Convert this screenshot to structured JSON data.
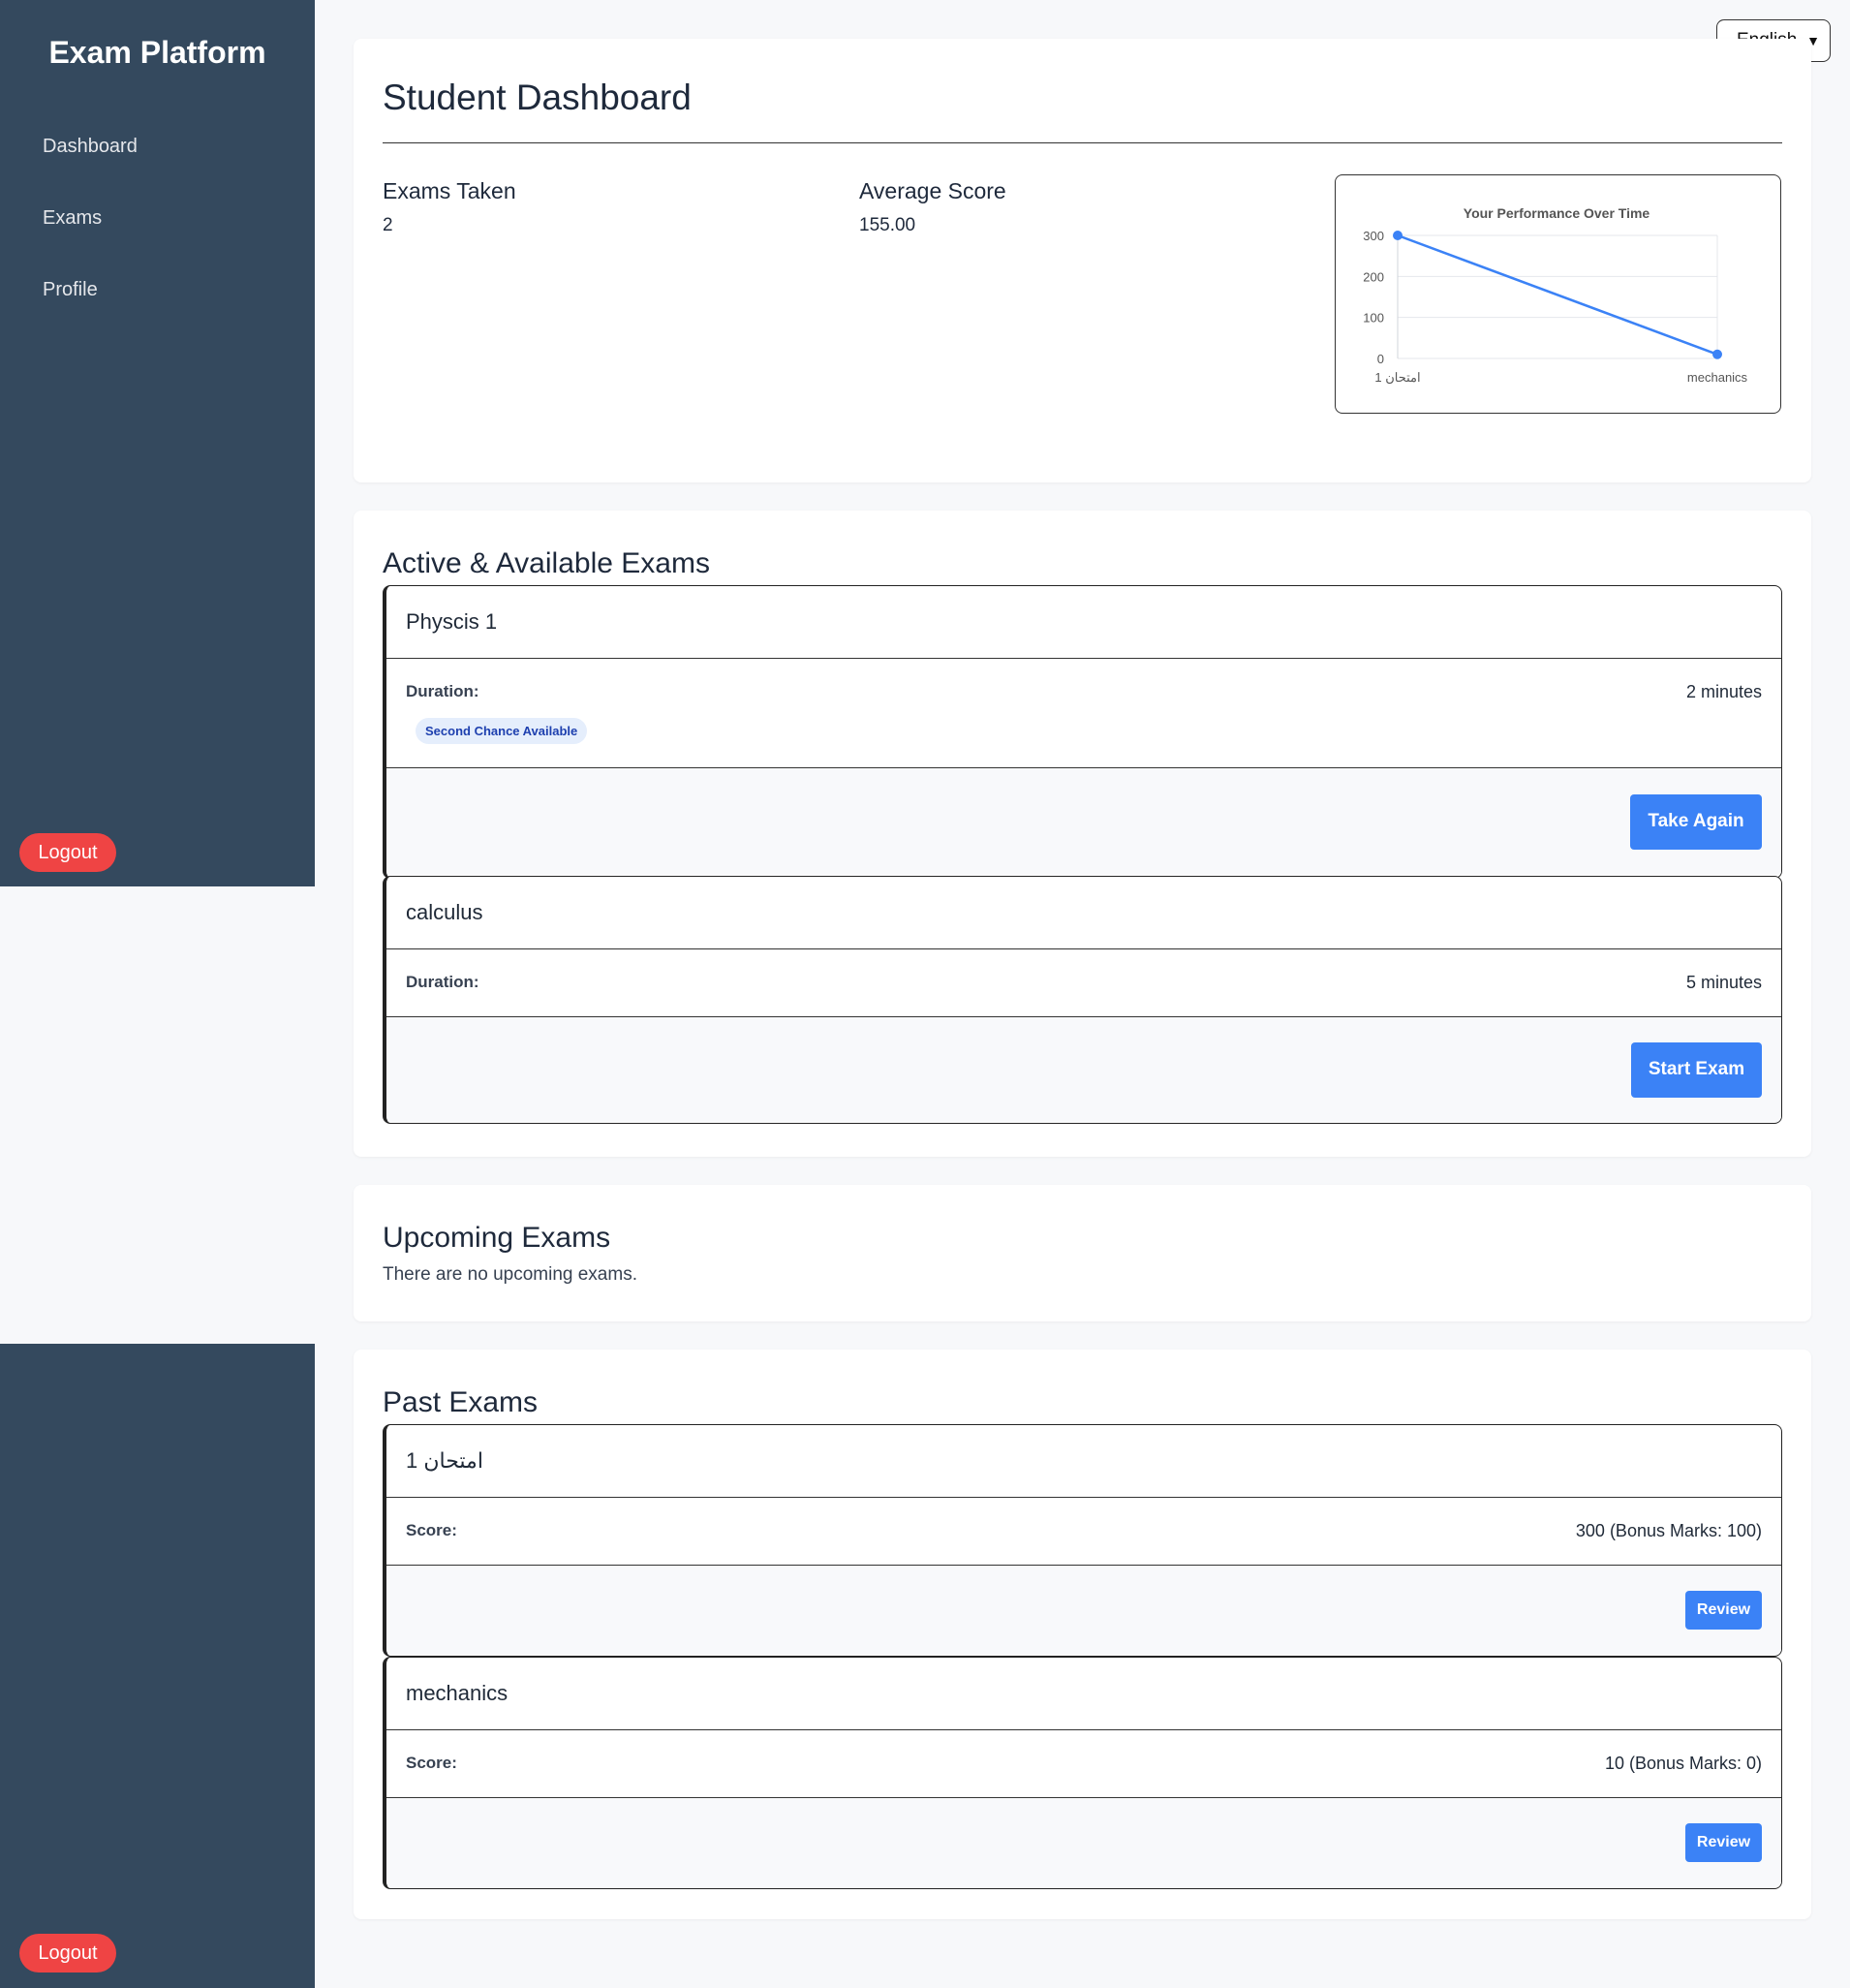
{
  "sidebar": {
    "brand": "Exam Platform",
    "items": [
      {
        "label": "Dashboard"
      },
      {
        "label": "Exams"
      },
      {
        "label": "Profile"
      }
    ],
    "logout_label": "Logout"
  },
  "language": {
    "selected": "English"
  },
  "dashboard": {
    "title": "Student Dashboard",
    "stats": {
      "exams_taken_label": "Exams Taken",
      "exams_taken_value": "2",
      "avg_score_label": "Average Score",
      "avg_score_value": "155.00"
    }
  },
  "chart_data": {
    "type": "line",
    "title": "Your Performance Over Time",
    "categories": [
      "امتحان 1",
      "mechanics"
    ],
    "series": [
      {
        "values": [
          300,
          10
        ]
      }
    ],
    "ylim": [
      0,
      300
    ],
    "yticks": [
      0,
      100,
      200,
      300
    ],
    "grid": true,
    "color": "#3b82f6"
  },
  "active_exams": {
    "title": "Active & Available Exams",
    "items": [
      {
        "name": "Physcis 1",
        "duration_label": "Duration:",
        "duration": "2 minutes",
        "badge": "Second Chance Available",
        "button": "Take Again"
      },
      {
        "name": "calculus",
        "duration_label": "Duration:",
        "duration": "5 minutes",
        "button": "Start Exam"
      }
    ]
  },
  "upcoming_exams": {
    "title": "Upcoming Exams",
    "empty_text": "There are no upcoming exams."
  },
  "past_exams": {
    "title": "Past Exams",
    "items": [
      {
        "name": "امتحان 1",
        "score_label": "Score:",
        "score": "300 (Bonus Marks: 100)",
        "button": "Review"
      },
      {
        "name": "mechanics",
        "score_label": "Score:",
        "score": "10 (Bonus Marks: 0)",
        "button": "Review"
      }
    ]
  },
  "colors": {
    "sidebar": "#34495e",
    "accent": "#3b82f6",
    "danger": "#ef4444"
  }
}
